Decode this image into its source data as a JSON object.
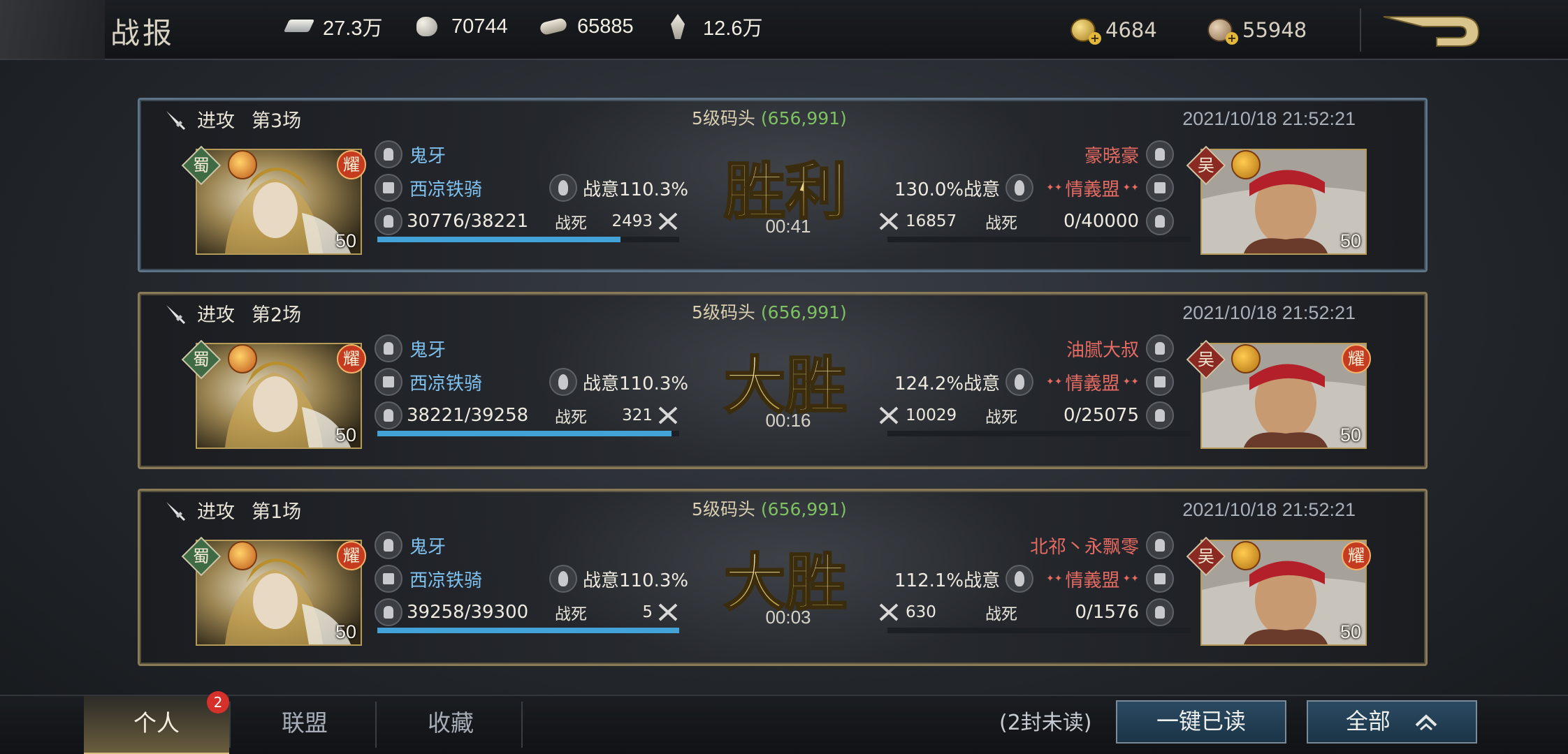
{
  "header": {
    "title": "战报",
    "resources": [
      {
        "icon": "silver-ingot-icon",
        "value": "27.3万"
      },
      {
        "icon": "stone-icon",
        "value": "70744"
      },
      {
        "icon": "wood-icon",
        "value": "65885"
      },
      {
        "icon": "grain-icon",
        "value": "12.6万"
      }
    ],
    "currencies": [
      {
        "icon": "gold-coin-icon",
        "value": "4684"
      },
      {
        "icon": "copper-coin-icon",
        "value": "55948"
      }
    ],
    "back_icon": "back-arrow-icon"
  },
  "reports": [
    {
      "mode": "进攻",
      "round": "第3场",
      "location": "5级码头",
      "coord": "(656,991)",
      "time": "2021/10/18 21:52:21",
      "result": "胜利",
      "duration": "00:41",
      "attacker": {
        "faction": "蜀",
        "tag": "耀",
        "level": "50",
        "name": "鬼牙",
        "army": "西凉铁骑",
        "morale": "战意110.3%",
        "troops": "30776/38221",
        "dead_label": "战死",
        "dead": "2493",
        "hp_fraction": 0.805
      },
      "defender": {
        "faction": "吴",
        "tag": "",
        "level": "50",
        "name": "豪晓豪",
        "alliance": "情義盟",
        "morale": "130.0%战意",
        "troops": "0/40000",
        "dead_label": "战死",
        "dead": "16857",
        "hp_fraction": 0.0
      }
    },
    {
      "mode": "进攻",
      "round": "第2场",
      "location": "5级码头",
      "coord": "(656,991)",
      "time": "2021/10/18 21:52:21",
      "result": "大胜",
      "duration": "00:16",
      "attacker": {
        "faction": "蜀",
        "tag": "耀",
        "level": "50",
        "name": "鬼牙",
        "army": "西凉铁骑",
        "morale": "战意110.3%",
        "troops": "38221/39258",
        "dead_label": "战死",
        "dead": "321",
        "hp_fraction": 0.974
      },
      "defender": {
        "faction": "吴",
        "tag": "耀",
        "level": "50",
        "name": "油腻大叔",
        "alliance": "情義盟",
        "morale": "124.2%战意",
        "troops": "0/25075",
        "dead_label": "战死",
        "dead": "10029",
        "hp_fraction": 0.0
      }
    },
    {
      "mode": "进攻",
      "round": "第1场",
      "location": "5级码头",
      "coord": "(656,991)",
      "time": "2021/10/18 21:52:21",
      "result": "大胜",
      "duration": "00:03",
      "attacker": {
        "faction": "蜀",
        "tag": "耀",
        "level": "50",
        "name": "鬼牙",
        "army": "西凉铁骑",
        "morale": "战意110.3%",
        "troops": "39258/39300",
        "dead_label": "战死",
        "dead": "5",
        "hp_fraction": 0.999
      },
      "defender": {
        "faction": "吴",
        "tag": "耀",
        "level": "50",
        "name": "北祁丶永飘零",
        "alliance": "情義盟",
        "morale": "112.1%战意",
        "troops": "0/1576",
        "dead_label": "战死",
        "dead": "630",
        "hp_fraction": 0.0
      }
    }
  ],
  "footer": {
    "tabs": [
      "个人",
      "联盟",
      "收藏"
    ],
    "active_tab": "个人",
    "unread_badge": "2",
    "unread_text": "(2封未读)",
    "mark_read_button": "一键已读",
    "filter_button": "全部"
  },
  "colors": {
    "attacker_name": "#7fc1ef",
    "defender_name": "#e66b62",
    "coord": "#7ec163",
    "win_bar": "#43a2d6",
    "loss_bar": "#8c2f33"
  }
}
